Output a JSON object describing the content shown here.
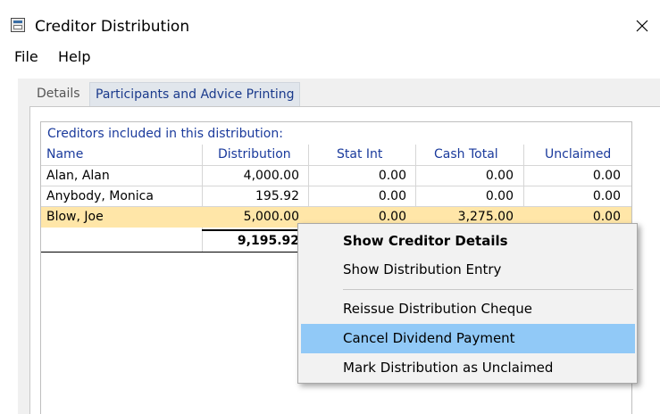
{
  "window": {
    "title": "Creditor Distribution"
  },
  "menu": {
    "file": "File",
    "help": "Help"
  },
  "tabs": {
    "details": "Details",
    "participants": "Participants and Advice Printing"
  },
  "grid": {
    "caption": "Creditors included in this distribution:",
    "columns": {
      "name": "Name",
      "distribution": "Distribution",
      "stat_int": "Stat Int",
      "cash_total": "Cash Total",
      "unclaimed": "Unclaimed"
    },
    "rows": [
      {
        "name": "Alan, Alan",
        "distribution": "4,000.00",
        "stat_int": "0.00",
        "cash_total": "0.00",
        "unclaimed": "0.00",
        "selected": false
      },
      {
        "name": "Anybody, Monica",
        "distribution": "195.92",
        "stat_int": "0.00",
        "cash_total": "0.00",
        "unclaimed": "0.00",
        "selected": false
      },
      {
        "name": "Blow, Joe",
        "distribution": "5,000.00",
        "stat_int": "0.00",
        "cash_total": "3,275.00",
        "unclaimed": "0.00",
        "selected": true
      }
    ],
    "total_distribution": "9,195.92"
  },
  "context_menu": {
    "items": [
      {
        "label": "Show Creditor Details",
        "bold": true
      },
      {
        "label": "Show Distribution Entry"
      },
      {
        "label": "Reissue Distribution Cheque"
      },
      {
        "label": "Cancel Dividend Payment",
        "highlighted": true
      },
      {
        "label": "Mark Distribution as Unclaimed"
      }
    ]
  },
  "colors": {
    "selected_row": "#ffe6a8",
    "menu_highlight": "#91c9f7",
    "header_text": "#1a3a9c"
  }
}
